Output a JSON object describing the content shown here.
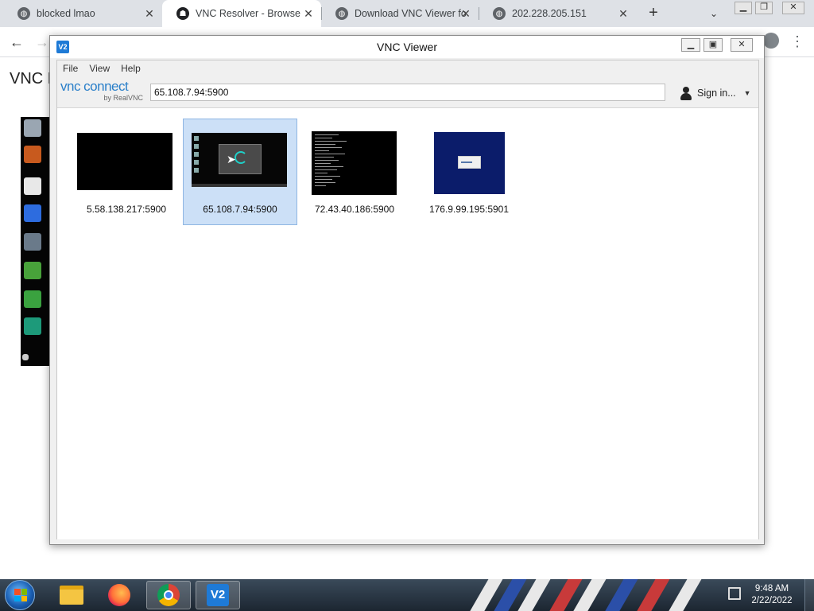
{
  "browser": {
    "tabs": [
      {
        "title": "blocked lmao",
        "active": false
      },
      {
        "title": "VNC Resolver - Browse",
        "active": true
      },
      {
        "title": "Download VNC Viewer fo",
        "active": false
      },
      {
        "title": "202.228.205.151",
        "active": false
      }
    ],
    "new_tab_label": "+",
    "page_heading": "VNC R"
  },
  "vnc": {
    "window_title": "VNC Viewer",
    "app_icon_text": "V2",
    "menu": [
      "File",
      "View",
      "Help"
    ],
    "logo_main": "vnc connect",
    "logo_sub": "by RealVNC",
    "address_value": "65.108.7.94:5900",
    "sign_in_label": "Sign in...",
    "connections": [
      {
        "label": "5.58.138.217:5900",
        "selected": false,
        "preview": "black"
      },
      {
        "label": "65.108.7.94:5900",
        "selected": true,
        "preview": "desktop"
      },
      {
        "label": "72.43.40.186:5900",
        "selected": false,
        "preview": "terminal"
      },
      {
        "label": "176.9.99.195:5901",
        "selected": false,
        "preview": "blue-screen"
      }
    ]
  },
  "taskbar": {
    "apps": [
      "windows-explorer",
      "firefox",
      "chrome",
      "vnc-viewer"
    ],
    "active_app": "vnc-viewer",
    "vnc_icon_text": "V2",
    "clock_time": "9:48 AM",
    "clock_date": "2/22/2022"
  },
  "colors": {
    "tabstrip_bg": "#dee1e6",
    "selection_bg": "#cce0f7",
    "vnc_brand": "#2a7fc9",
    "taskbar_bg": "#1c2631"
  }
}
